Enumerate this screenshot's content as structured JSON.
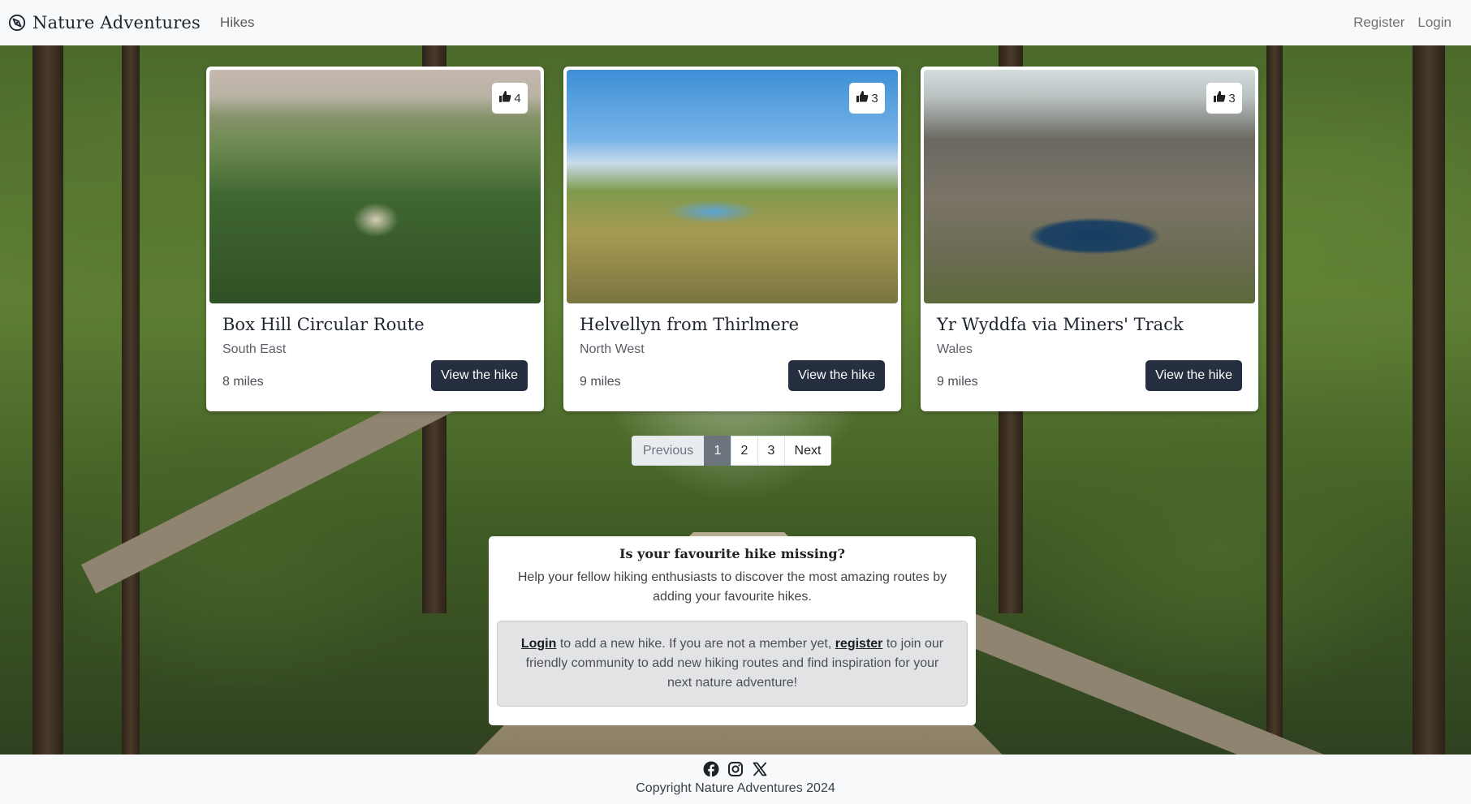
{
  "navbar": {
    "brand_icon": "compass-icon",
    "brand": "Nature Adventures",
    "hikes_link": "Hikes",
    "register_link": "Register",
    "login_link": "Login"
  },
  "hikes": [
    {
      "title": "Box Hill Circular Route",
      "region": "South East",
      "distance": "8 miles",
      "likes": "4",
      "button": "View the hike"
    },
    {
      "title": "Helvellyn from Thirlmere",
      "region": "North West",
      "distance": "9 miles",
      "likes": "3",
      "button": "View the hike"
    },
    {
      "title": "Yr Wyddfa via Miners' Track",
      "region": "Wales",
      "distance": "9 miles",
      "likes": "3",
      "button": "View the hike"
    }
  ],
  "pagination": {
    "previous": "Previous",
    "pages": [
      "1",
      "2",
      "3"
    ],
    "current": "1",
    "next": "Next"
  },
  "info": {
    "title": "Is your favourite hike missing?",
    "description": "Help your fellow hiking enthusiasts to discover the most amazing routes by adding your favourite hikes.",
    "login_link": "Login",
    "text_1": " to add a new hike. If you are not a member yet, ",
    "register_link": "register",
    "text_2": " to join our friendly community to add new hiking routes and find inspiration for your next nature adventure!"
  },
  "footer": {
    "icons": [
      "facebook-icon",
      "instagram-icon",
      "x-icon"
    ],
    "copyright": "Copyright Nature Adventures 2024"
  },
  "colors": {
    "button_dark": "#252f3f",
    "navbar_bg": "#f8f9fa",
    "page_active": "#6c757d"
  }
}
